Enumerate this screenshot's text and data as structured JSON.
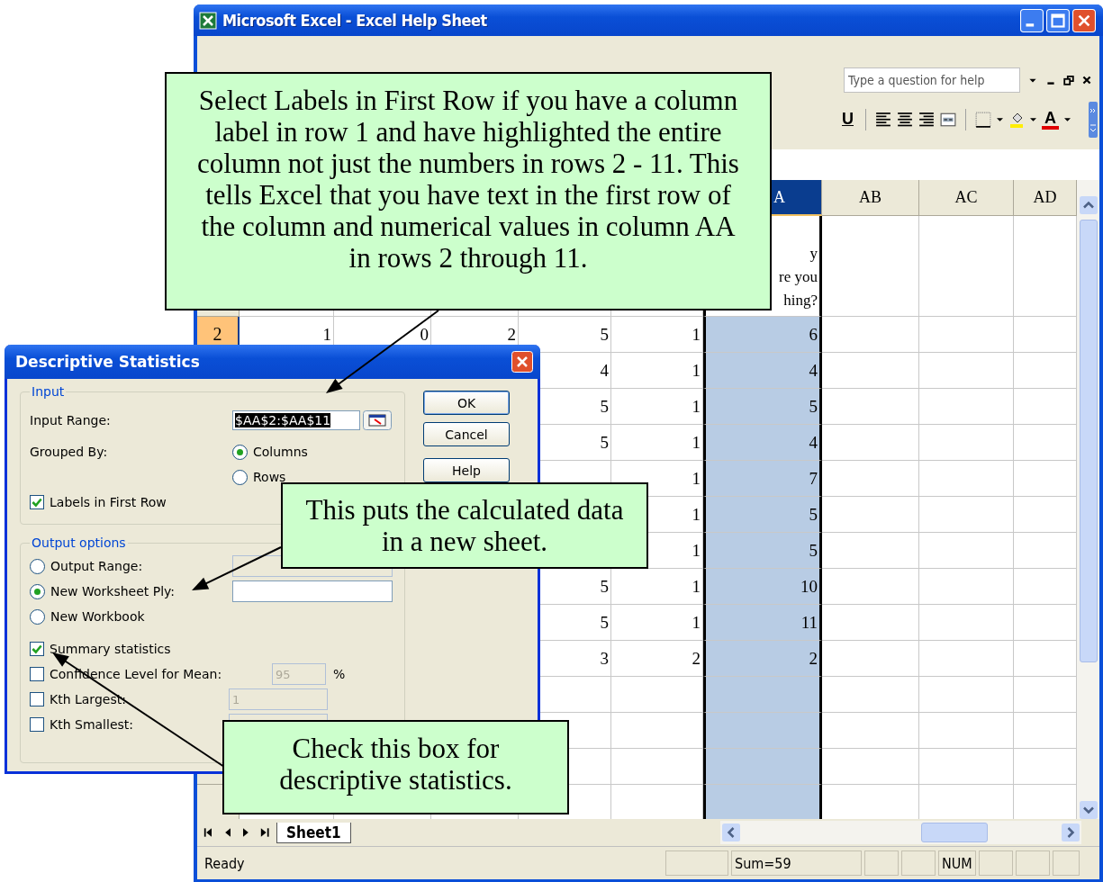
{
  "window": {
    "title": "Microsoft Excel - Excel Help Sheet"
  },
  "help_box": {
    "placeholder": "Type a question for help"
  },
  "format_toolbar": {
    "underline": "U",
    "font_color": "A"
  },
  "sheet": {
    "columns": [
      {
        "selected": false
      },
      {
        "selected": false
      },
      {
        "selected": false
      },
      {
        "selected": false
      },
      {
        "selected": false
      },
      {
        "label": "A",
        "selected": true
      },
      {
        "label": "AB",
        "selected": false
      },
      {
        "label": "AC",
        "selected": false
      },
      {
        "label": "AD",
        "selected": false
      }
    ],
    "rows": [
      {
        "cells": [
          null,
          null,
          null,
          null,
          null,
          "y\nre you\nhing?"
        ]
      },
      {
        "header": "2",
        "selected": true,
        "cells": [
          "1",
          "0",
          "2",
          "5",
          "1",
          "6"
        ]
      },
      {
        "cells": [
          null,
          null,
          null,
          "4",
          "1",
          "4"
        ]
      },
      {
        "cells": [
          null,
          null,
          null,
          "5",
          "1",
          "5"
        ]
      },
      {
        "cells": [
          null,
          null,
          null,
          "5",
          "1",
          "4"
        ]
      },
      {
        "cells": [
          null,
          null,
          null,
          null,
          "1",
          "7"
        ]
      },
      {
        "cells": [
          null,
          null,
          null,
          null,
          "1",
          "5"
        ]
      },
      {
        "cells": [
          null,
          null,
          null,
          null,
          "1",
          "5"
        ]
      },
      {
        "cells": [
          null,
          null,
          null,
          "5",
          "1",
          "10"
        ]
      },
      {
        "cells": [
          null,
          null,
          null,
          "5",
          "1",
          "11"
        ]
      },
      {
        "cells": [
          null,
          null,
          null,
          "3",
          "2",
          "2"
        ]
      }
    ],
    "tabs": [
      {
        "label": "Sheet1",
        "selected": true
      }
    ]
  },
  "status_bar": {
    "text": "Ready",
    "sum": "Sum=59",
    "num": "NUM"
  },
  "dialog": {
    "title": "Descriptive Statistics",
    "input_group": {
      "title": "Input",
      "input_range": {
        "label": "Input Range:",
        "value": "$AA$2:$AA$11"
      },
      "grouped_by": {
        "label": "Grouped By:",
        "options": [
          {
            "label": "Columns",
            "selected": true
          },
          {
            "label": "Rows",
            "selected": false
          }
        ]
      },
      "labels_in_first_row": {
        "label": "Labels in First Row",
        "checked": true
      }
    },
    "output_group": {
      "title": "Output options",
      "destinations": [
        {
          "label": "Output Range:",
          "selected": false,
          "field": {
            "disabled": true
          }
        },
        {
          "label": "New Worksheet Ply:",
          "selected": true,
          "field": {
            "disabled": false
          }
        },
        {
          "label": "New Workbook",
          "selected": false
        }
      ],
      "options": [
        {
          "label": "Summary statistics",
          "checked": true
        },
        {
          "label": "Confidence Level for Mean:",
          "checked": false,
          "field": {
            "value": "95",
            "disabled": true
          },
          "unit": "%"
        },
        {
          "label": "Kth Largest:",
          "checked": false,
          "field": {
            "value": "1",
            "disabled": true
          }
        },
        {
          "label": "Kth Smallest:",
          "checked": false,
          "field": {
            "disabled": true
          }
        }
      ]
    },
    "buttons": [
      {
        "label": "OK",
        "default": true
      },
      {
        "label": "Cancel",
        "default": false
      },
      {
        "label": "Help",
        "default": false
      }
    ]
  },
  "callouts": [
    {
      "text": "Select Labels in First Row if you have a column label in row 1 and have highlighted the entire column not just the numbers in rows 2 - 11. This tells Excel that you have text in the first row of the column and numerical values in column AA in rows 2 through 11."
    },
    {
      "text": "This puts the calculated data in a new sheet."
    },
    {
      "text": "Check this box for descriptive statistics."
    }
  ]
}
